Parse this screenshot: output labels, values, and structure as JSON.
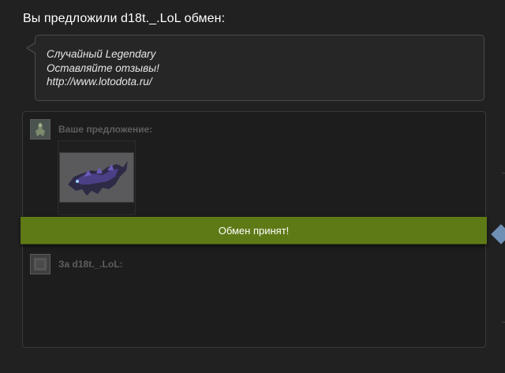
{
  "header": {
    "title": "Вы предложили d18t._.LoL обмен:"
  },
  "message": {
    "lines": [
      "Случайный Legendary",
      "Оставляйте отзывы!",
      "http://www.lotodota.ru/"
    ]
  },
  "trade": {
    "your_offer_label": "Ваше предложение:",
    "their_offer_label": "За d18t._.LoL:",
    "status": "Обмен принят!"
  },
  "icons": {
    "your_avatar": "hero-avatar-icon",
    "their_avatar": "default-avatar-icon",
    "item": "creature-item-icon"
  },
  "colors": {
    "background": "#212121",
    "panel": "#1d1d1d",
    "status_bar": "#5e7a16",
    "side_arrow": "#6f8fb5"
  }
}
